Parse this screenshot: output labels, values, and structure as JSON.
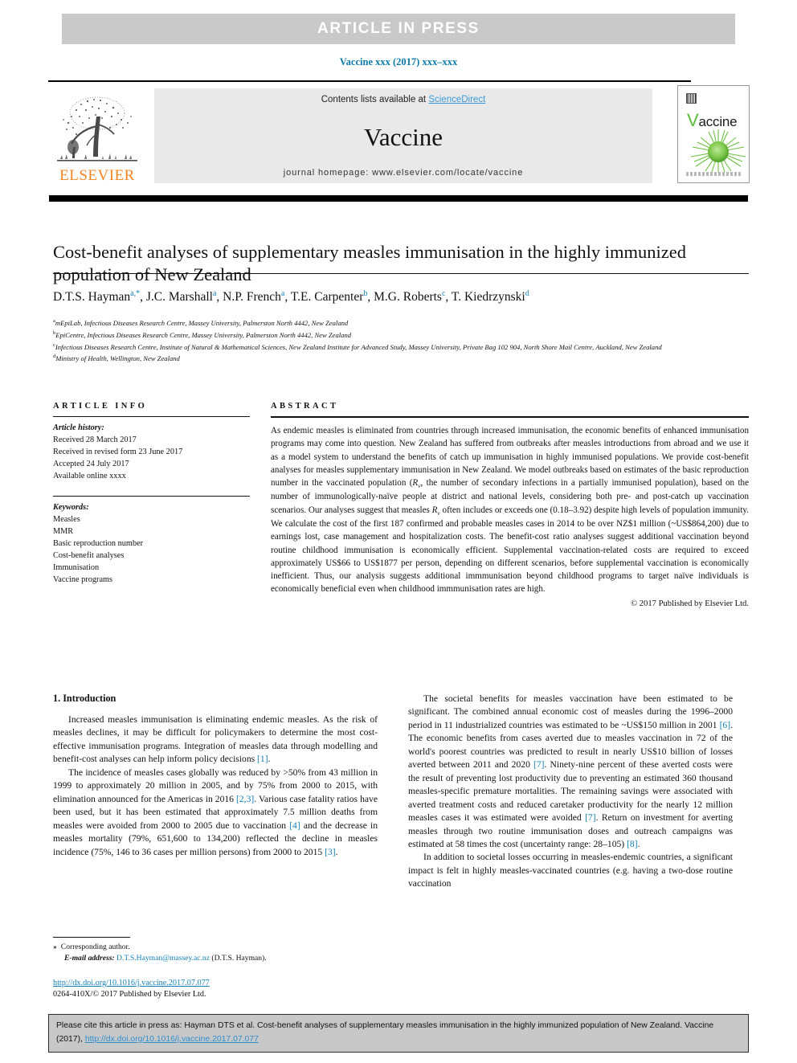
{
  "banner": {
    "label": "ARTICLE  IN  PRESS"
  },
  "running_head": {
    "text": "Vaccine xxx (2017) xxx–xxx"
  },
  "masthead": {
    "contents_prefix": "Contents lists available at ",
    "sciencedirect": "ScienceDirect",
    "journal_title": "Vaccine",
    "homepage": "journal homepage: www.elsevier.com/locate/vaccine",
    "publisher_logo_text": "ELSEVIER",
    "cover_title": "accine",
    "cover_initial": "V"
  },
  "article": {
    "title": "Cost-benefit analyses of supplementary measles immunisation in the highly immunized population of New Zealand",
    "authors_html": "D.T.S. Hayman<sup class=\"star\">a,*</sup>, J.C. Marshall<sup>a</sup>, N.P. French<sup>a</sup>, T.E. Carpenter<sup>b</sup>, M.G. Roberts<sup>c</sup>, T. Kiedrzynski<sup>d</sup>",
    "affiliations": [
      {
        "marker": "a",
        "text": "mEpiLab, Infectious Diseases Research Centre, Massey University, Palmerston North 4442, New Zealand"
      },
      {
        "marker": "b",
        "text": "EpiCentre, Infectious Diseases Research Centre, Massey University, Palmerston North 4442, New Zealand"
      },
      {
        "marker": "c",
        "text": "Infectious Diseases Research Centre, Institute of Natural & Mathematical Sciences, New Zealand Institute for Advanced Study, Massey University, Private Bag 102 904, North Shore Mail Centre, Auckland, New Zealand"
      },
      {
        "marker": "d",
        "text": "Ministry of Health, Wellington, New Zealand"
      }
    ]
  },
  "article_info": {
    "heading": "ARTICLE INFO",
    "history_label": "Article history:",
    "history": [
      "Received 28 March 2017",
      "Received in revised form 23 June 2017",
      "Accepted 24 July 2017",
      "Available online xxxx"
    ],
    "keywords_label": "Keywords:",
    "keywords": [
      "Measles",
      "MMR",
      "Basic reproduction number",
      "Cost-benefit analyses",
      "Immunisation",
      "Vaccine programs"
    ]
  },
  "abstract": {
    "heading": "ABSTRACT",
    "body_html": "As endemic measles is eliminated from countries through increased immunisation, the economic benefits of enhanced immunisation programs may come into question. New Zealand has suffered from outbreaks after measles introductions from abroad and we use it as a model system to understand the benefits of catch up immunisation in highly immunised populations. We provide cost-benefit analyses for measles supplementary immunisation in New Zealand. We model outbreaks based on estimates of the basic reproduction number in the vaccinated population (<i>R<sub>v</sub></i>, the number of secondary infections in a partially immunised population), based on the number of immunologically-naïve people at district and national levels, considering both pre- and post-catch up vaccination scenarios. Our analyses suggest that measles <i>R<sub>v</sub></i> often includes or exceeds one (0.18–3.92) despite high levels of population immunity. We calculate the cost of the first 187 confirmed and probable measles cases in 2014 to be over NZ$1 million (~US$864,200) due to earnings lost, case management and hospitalization costs. The benefit-cost ratio analyses suggest additional vaccination beyond routine childhood immunisation is economically efficient. Supplemental vaccination-related costs are required to exceed approximately US$66 to US$1877 per person, depending on different scenarios, before supplemental vaccination is economically inefficient. Thus, our analysis suggests additional immmunisation beyond childhood programs to target naïve individuals is economically beneficial even when childhood immmunisation rates are high.",
    "copyright": "© 2017 Published by Elsevier Ltd."
  },
  "intro": {
    "heading": "1. Introduction",
    "left_paragraphs_html": [
      "Increased measles immunisation is eliminating endemic measles. As the risk of measles declines, it may be difficult for policymakers to determine the most cost-effective immunisation programs. Integration of measles data through modelling and benefit-cost analyses can help inform policy decisions <span class=\"ref\">[1]</span>.",
      "The incidence of measles cases globally was reduced by &gt;50% from 43 million in 1999 to approximately 20 million in 2005, and by 75% from 2000 to 2015, with elimination announced for the Americas in 2016 <span class=\"ref\">[2,3]</span>. Various case fatality ratios have been used, but it has been estimated that approximately 7.5 million deaths from measles were avoided from 2000 to 2005 due to vaccination <span class=\"ref\">[4]</span> and the decrease in measles mortality (79%, 651,600 to 134,200) reflected the decline in measles incidence (75%, 146 to 36 cases per million persons) from 2000 to 2015 <span class=\"ref\">[3]</span>."
    ],
    "right_paragraphs_html": [
      "The societal benefits for measles vaccination have been estimated to be significant. The combined annual economic cost of measles during the 1996–2000 period in 11 industrialized countries was estimated to be ~US$150 million in 2001 <span class=\"ref\">[6]</span>. The economic benefits from cases averted due to measles vaccination in 72 of the world's poorest countries was predicted to result in nearly US$10 billion of losses averted between 2011 and 2020 <span class=\"ref\">[7]</span>. Ninety-nine percent of these averted costs were the result of preventing lost productivity due to preventing an estimated 360 thousand measles-specific premature mortalities. The remaining savings were associated with averted treatment costs and reduced caretaker productivity for the nearly 12 million measles cases it was estimated were avoided <span class=\"ref\">[7]</span>. Return on investment for averting measles through two routine immunisation doses and outreach campaigns was estimated at 58 times the cost (uncertainty range: 28–105) <span class=\"ref\">[8]</span>.",
      "In addition to societal losses occurring in measles-endemic countries, a significant impact is felt in highly measles-vaccinated countries (e.g. having a two-dose routine vaccination"
    ]
  },
  "footnote": {
    "corresponding_marker": "⁎",
    "corresponding_label": "Corresponding author.",
    "email_label": "E-mail address:",
    "email": "D.T.S.Hayman@massey.ac.nz",
    "email_owner": "(D.T.S. Hayman)."
  },
  "doi_block": {
    "doi_url": "http://dx.doi.org/10.1016/j.vaccine.2017.07.077",
    "issn_line": "0264-410X/© 2017 Published by Elsevier Ltd."
  },
  "cite_box": {
    "text_part1": "Please cite this article in press as: Hayman DTS et al. Cost-benefit analyses of supplementary measles immunisation in the highly immunized population of New Zealand. Vaccine (2017), ",
    "link": "http://dx.doi.org/10.1016/j.vaccine.2017.07.077"
  },
  "colors": {
    "link_blue": "#1481b8",
    "sciencedirect_blue": "#3a9ad9",
    "elsevier_orange": "#f08522",
    "banner_grey": "#c9c9c9",
    "masthead_grey": "#e9e9e9",
    "cite_box_grey": "#c8c8c8",
    "cover_green": "#5cbb3a"
  }
}
